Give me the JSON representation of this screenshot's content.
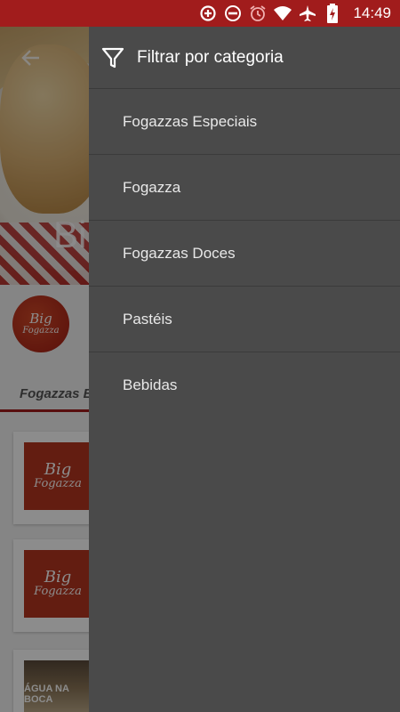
{
  "status_bar": {
    "time": "14:49",
    "icons": [
      "data-saver-icon",
      "do-not-disturb-icon",
      "alarm-icon",
      "wifi-icon",
      "airplane-icon",
      "battery-charging-icon"
    ]
  },
  "background": {
    "hero_title": "Bi",
    "tab_label": "Fogazzas Es",
    "logo_line1": "Big",
    "logo_line2": "Fogazza",
    "cards": [
      {
        "line1": "Big",
        "line2": "Fogazza"
      },
      {
        "line1": "Big",
        "line2": "Fogazza"
      },
      {
        "line1": "ÁGUA NA BOCA",
        "line2": ""
      }
    ]
  },
  "drawer": {
    "title": "Filtrar por categoria",
    "items": [
      {
        "label": "Fogazzas Especiais"
      },
      {
        "label": "Fogazza"
      },
      {
        "label": "Fogazzas Doces"
      },
      {
        "label": "Pastéis"
      },
      {
        "label": "Bebidas"
      }
    ]
  },
  "colors": {
    "status_bar": "#a11c1c",
    "drawer_bg": "#4a4a4a",
    "accent": "#a11c1c"
  }
}
